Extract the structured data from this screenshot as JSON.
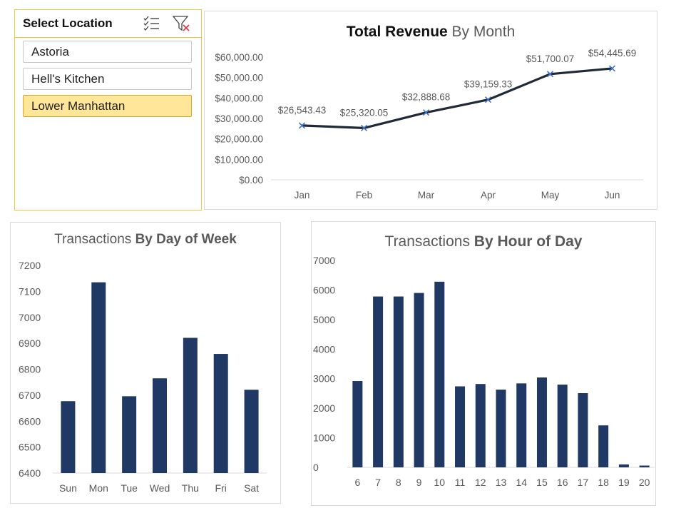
{
  "slicer": {
    "title": "Select Location",
    "icons": {
      "multi_select": "multi-select-icon",
      "clear_filter": "clear-filter-icon"
    },
    "items": [
      {
        "label": "Astoria",
        "selected": false
      },
      {
        "label": "Hell's Kitchen",
        "selected": false
      },
      {
        "label": "Lower Manhattan",
        "selected": true
      }
    ]
  },
  "colors": {
    "bar": "#203864",
    "line": "#1f2937",
    "marker": "#4472c4",
    "slicer_selected": "#ffe699",
    "slicer_border": "#f0c74a"
  },
  "chart_data": [
    {
      "type": "line",
      "title_bold": "Total Revenue",
      "title_regular": "By Month",
      "categories": [
        "Jan",
        "Feb",
        "Mar",
        "Apr",
        "May",
        "Jun"
      ],
      "values": [
        26543.43,
        25320.05,
        32888.68,
        39159.33,
        51700.07,
        54445.69
      ],
      "data_labels": [
        "$26,543.43",
        "$25,320.05",
        "$32,888.68",
        "$39,159.33",
        "$51,700.07",
        "$54,445.69"
      ],
      "ylim": [
        0,
        60000
      ],
      "yticks": [
        0,
        10000,
        20000,
        30000,
        40000,
        50000,
        60000
      ],
      "ytick_labels": [
        "$0.00",
        "$10,000.00",
        "$20,000.00",
        "$30,000.00",
        "$40,000.00",
        "$50,000.00",
        "$60,000.00"
      ],
      "grid": false,
      "marker": "x"
    },
    {
      "type": "bar",
      "title_regular": "Transactions",
      "title_bold": "By Day of Week",
      "categories": [
        "Sun",
        "Mon",
        "Tue",
        "Wed",
        "Thu",
        "Fri",
        "Sat"
      ],
      "values": [
        6677,
        7135,
        6696,
        6765,
        6921,
        6859,
        6721
      ],
      "ylim": [
        6400,
        7200
      ],
      "yticks": [
        6400,
        6500,
        6600,
        6700,
        6800,
        6900,
        7000,
        7100,
        7200
      ],
      "ytick_labels": [
        "6400",
        "6500",
        "6600",
        "6700",
        "6800",
        "6900",
        "7000",
        "7100",
        "7200"
      ],
      "grid": false
    },
    {
      "type": "bar",
      "title_regular": "Transactions",
      "title_bold": "By Hour of Day",
      "categories": [
        "6",
        "7",
        "8",
        "9",
        "10",
        "11",
        "12",
        "13",
        "14",
        "15",
        "16",
        "17",
        "18",
        "19",
        "20"
      ],
      "values": [
        2920,
        5780,
        5780,
        5900,
        6280,
        2740,
        2820,
        2630,
        2840,
        3040,
        2800,
        2510,
        1420,
        100,
        60
      ],
      "ylim": [
        0,
        7000
      ],
      "yticks": [
        0,
        1000,
        2000,
        3000,
        4000,
        5000,
        6000,
        7000
      ],
      "ytick_labels": [
        "0",
        "1000",
        "2000",
        "3000",
        "4000",
        "5000",
        "6000",
        "7000"
      ],
      "grid": false
    }
  ]
}
